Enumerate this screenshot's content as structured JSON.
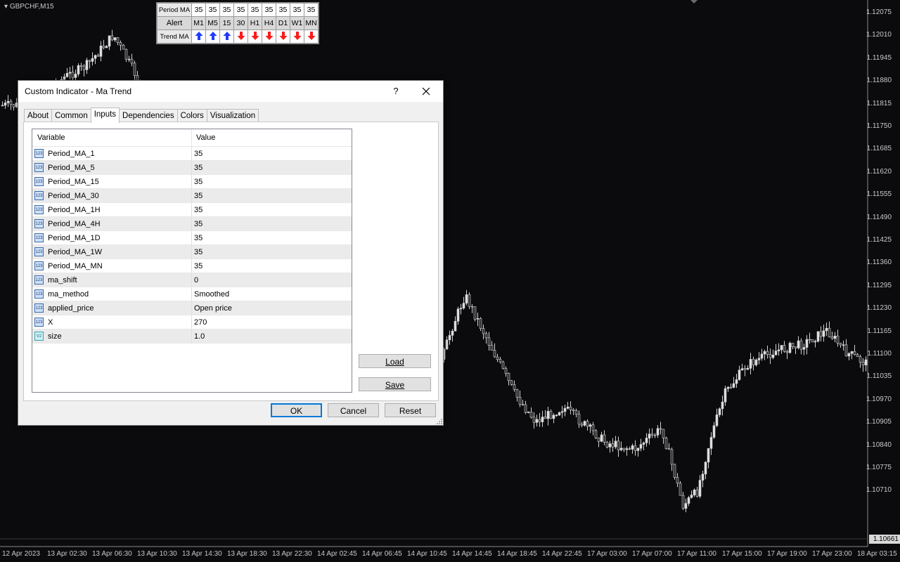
{
  "chart": {
    "symbol": "GBPCHF,M15",
    "current_price": "1.10661",
    "price_axis": [
      "1.12075",
      "1.12010",
      "1.11945",
      "1.11880",
      "1.11815",
      "1.11750",
      "1.11685",
      "1.11620",
      "1.11555",
      "1.11490",
      "1.11425",
      "1.11360",
      "1.11295",
      "1.11230",
      "1.11165",
      "1.11100",
      "1.11035",
      "1.10970",
      "1.10905",
      "1.10840",
      "1.10775",
      "1.10710"
    ],
    "time_axis": [
      "12 Apr 2023",
      "13 Apr 02:30",
      "13 Apr 06:30",
      "13 Apr 10:30",
      "13 Apr 14:30",
      "13 Apr 18:30",
      "13 Apr 22:30",
      "14 Apr 02:45",
      "14 Apr 06:45",
      "14 Apr 10:45",
      "14 Apr 14:45",
      "14 Apr 18:45",
      "14 Apr 22:45",
      "17 Apr 03:00",
      "17 Apr 07:00",
      "17 Apr 11:00",
      "17 Apr 15:00",
      "17 Apr 19:00",
      "17 Apr 23:00",
      "18 Apr 03:15"
    ],
    "bull_color": "#e0e0e0",
    "bear_color": "#2a2a2a"
  },
  "ma_panel": {
    "period_label": "Period MA",
    "periods": [
      "35",
      "35",
      "35",
      "35",
      "35",
      "35",
      "35",
      "35",
      "35"
    ],
    "alert_label": "Alert",
    "timeframes": [
      "M1",
      "M5",
      "15",
      "30",
      "H1",
      "H4",
      "D1",
      "W1",
      "MN"
    ],
    "trend_label": "Trend MA",
    "trends": [
      "up",
      "up",
      "up",
      "down",
      "down",
      "down",
      "down",
      "down",
      "down"
    ],
    "up_color": "#1f3cff",
    "down_color": "#ff1a1a"
  },
  "dialog": {
    "title": "Custom Indicator - Ma Trend",
    "help": "?",
    "tabs": [
      {
        "label": "About"
      },
      {
        "label": "Common"
      },
      {
        "label": "Inputs",
        "active": true
      },
      {
        "label": "Dependencies"
      },
      {
        "label": "Colors"
      },
      {
        "label": "Visualization"
      }
    ],
    "grid": {
      "col_variable": "Variable",
      "col_value": "Value",
      "rows": [
        {
          "icon": "int",
          "name": "Period_MA_1",
          "value": "35"
        },
        {
          "icon": "int",
          "name": "Period_MA_5",
          "value": "35"
        },
        {
          "icon": "int",
          "name": "Period_MA_15",
          "value": "35"
        },
        {
          "icon": "int",
          "name": "Period_MA_30",
          "value": "35"
        },
        {
          "icon": "int",
          "name": "Period_MA_1H",
          "value": "35"
        },
        {
          "icon": "int",
          "name": "Period_MA_4H",
          "value": "35"
        },
        {
          "icon": "int",
          "name": "Period_MA_1D",
          "value": "35"
        },
        {
          "icon": "int",
          "name": "Period_MA_1W",
          "value": "35"
        },
        {
          "icon": "int",
          "name": "Period_MA_MN",
          "value": "35"
        },
        {
          "icon": "int",
          "name": "ma_shift",
          "value": "0"
        },
        {
          "icon": "int",
          "name": "ma_method",
          "value": "Smoothed"
        },
        {
          "icon": "int",
          "name": "applied_price",
          "value": "Open price"
        },
        {
          "icon": "int",
          "name": "X",
          "value": "270"
        },
        {
          "icon": "double",
          "name": "size",
          "value": "1.0"
        }
      ]
    },
    "buttons": {
      "load": "Load",
      "save": "Save",
      "ok": "OK",
      "cancel": "Cancel",
      "reset": "Reset"
    },
    "icon_text": {
      "int": "123",
      "double": "V2"
    }
  }
}
